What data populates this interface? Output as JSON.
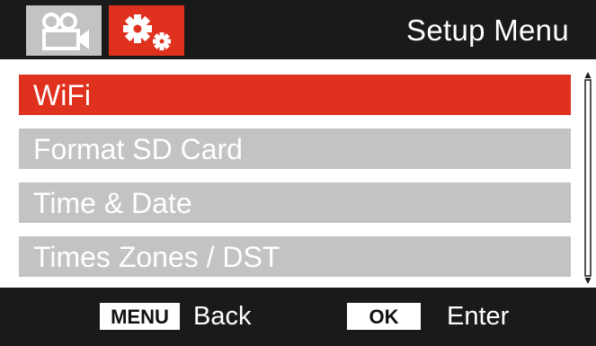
{
  "header": {
    "tabs": [
      {
        "name": "video",
        "icon": "video-camera-icon",
        "active": false
      },
      {
        "name": "setup",
        "icon": "gears-icon",
        "active": true
      }
    ],
    "title": "Setup Menu"
  },
  "menu": {
    "items": [
      {
        "label": "WiFi",
        "selected": true
      },
      {
        "label": "Format SD Card",
        "selected": false
      },
      {
        "label": "Time & Date",
        "selected": false
      },
      {
        "label": "Times Zones / DST",
        "selected": false
      }
    ]
  },
  "footer": {
    "menu_key": "MENU",
    "menu_action": "Back",
    "ok_key": "OK",
    "ok_action": "Enter"
  },
  "colors": {
    "accent": "#e0311f",
    "inactive": "#c3c3c3",
    "background": "#1a1a1a"
  }
}
